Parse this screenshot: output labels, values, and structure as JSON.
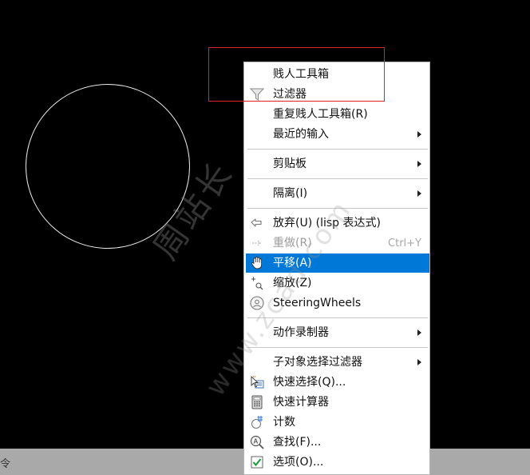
{
  "statusbar": {
    "text": "令"
  },
  "menu": {
    "items": [
      {
        "label": "贱人工具箱",
        "icon": "",
        "submenu": false,
        "enabled": true,
        "highlighted": false
      },
      {
        "label": "过滤器",
        "icon": "filter-icon",
        "submenu": false,
        "enabled": true,
        "highlighted": false
      },
      {
        "label": "重复贱人工具箱(R)",
        "icon": "",
        "submenu": false,
        "enabled": true,
        "highlighted": false
      },
      {
        "label": "最近的输入",
        "icon": "",
        "submenu": true,
        "enabled": true,
        "highlighted": false
      },
      {
        "label": "剪贴板",
        "icon": "",
        "submenu": true,
        "enabled": true,
        "highlighted": false
      },
      {
        "label": "隔离(I)",
        "icon": "",
        "submenu": true,
        "enabled": true,
        "highlighted": false
      },
      {
        "label": "放弃(U) (lisp 表达式)",
        "icon": "undo-icon",
        "submenu": false,
        "enabled": true,
        "highlighted": false
      },
      {
        "label": "重做(R)",
        "icon": "redo-icon",
        "shortcut": "Ctrl+Y",
        "submenu": false,
        "enabled": false,
        "highlighted": false
      },
      {
        "label": "平移(A)",
        "icon": "pan-hand-icon",
        "submenu": false,
        "enabled": true,
        "highlighted": true
      },
      {
        "label": "缩放(Z)",
        "icon": "zoom-icon",
        "submenu": false,
        "enabled": true,
        "highlighted": false
      },
      {
        "label": "SteeringWheels",
        "icon": "steering-wheel-icon",
        "submenu": false,
        "enabled": true,
        "highlighted": false
      },
      {
        "label": "动作录制器",
        "icon": "",
        "submenu": true,
        "enabled": true,
        "highlighted": false
      },
      {
        "label": "子对象选择过滤器",
        "icon": "",
        "submenu": true,
        "enabled": true,
        "highlighted": false
      },
      {
        "label": "快速选择(Q)...",
        "icon": "quick-select-icon",
        "submenu": false,
        "enabled": true,
        "highlighted": false
      },
      {
        "label": "快速计算器",
        "icon": "calculator-icon",
        "submenu": false,
        "enabled": true,
        "highlighted": false
      },
      {
        "label": "计数",
        "icon": "count-icon",
        "submenu": false,
        "enabled": true,
        "highlighted": false
      },
      {
        "label": "查找(F)...",
        "icon": "find-icon",
        "submenu": false,
        "enabled": true,
        "highlighted": false
      },
      {
        "label": "选项(O)...",
        "icon": "options-check-icon",
        "submenu": false,
        "enabled": true,
        "highlighted": false
      }
    ]
  },
  "watermark": {
    "line1": "周站长",
    "line2": "www.zcad.com"
  },
  "colors": {
    "highlight": "#0078d7",
    "annotation_box": "#e0212b",
    "canvas": "#000000"
  }
}
